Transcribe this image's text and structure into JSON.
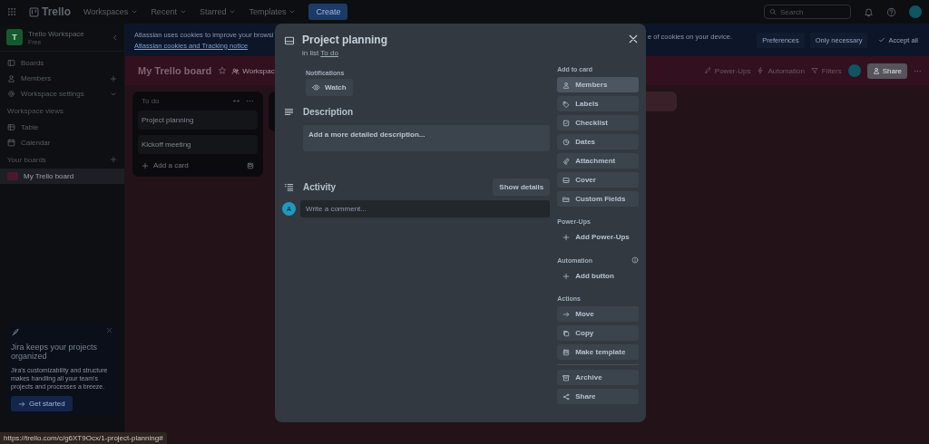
{
  "top_nav": {
    "logo": "Trello",
    "menus": [
      {
        "label": "Workspaces"
      },
      {
        "label": "Recent"
      },
      {
        "label": "Starred"
      },
      {
        "label": "Templates"
      }
    ],
    "create": "Create",
    "search": {
      "placeholder": "Search"
    }
  },
  "sidebar": {
    "workspace": {
      "initial": "T",
      "name": "Trello Workspace",
      "plan": "Free"
    },
    "items": [
      {
        "label": "Boards"
      },
      {
        "label": "Members"
      },
      {
        "label": "Workspace settings"
      }
    ],
    "views_heading": "Workspace views",
    "views": [
      {
        "label": "Table"
      },
      {
        "label": "Calendar"
      }
    ],
    "boards_heading": "Your boards",
    "boards": [
      {
        "label": "My Trello board",
        "selected": true
      }
    ],
    "promo": {
      "title": "Jira keeps your projects organized",
      "body": "Jira's customizability and structure makes handling all your team's projects and processes a breeze.",
      "button": "Get started"
    }
  },
  "cookie_banner": {
    "text_left": "Atlassian uses cookies to improve your browsi",
    "link": "Atlassian cookies and Tracking notice",
    "text_right": "e of cookies on your device.",
    "buttons": [
      {
        "label": "Preferences",
        "kind": "plain"
      },
      {
        "label": "Only necessary",
        "kind": "plain"
      },
      {
        "label": "Accept all",
        "kind": "check"
      }
    ]
  },
  "board": {
    "title": "My Trello board",
    "visibility": "Workspac",
    "actions": [
      {
        "label": "Power-Ups"
      },
      {
        "label": "Automation"
      },
      {
        "label": "Filters"
      }
    ],
    "share": "Share",
    "lists": [
      {
        "title": "To do",
        "cards": [
          "Project planning",
          "Kickoff meeting"
        ],
        "add": "Add a card"
      }
    ]
  },
  "card_modal": {
    "title": "Project planning",
    "list_prefix": "in list",
    "list_name": "To do",
    "notifications_label": "Notifications",
    "watch": "Watch",
    "description_heading": "Description",
    "description_placeholder": "Add a more detailed description...",
    "activity_heading": "Activity",
    "show_details": "Show details",
    "avatar_initial": "A",
    "comment_placeholder": "Write a comment...",
    "sections": [
      {
        "heading": "Add to card",
        "info": false,
        "groups": [
          [
            {
              "label": "Members",
              "kind": "button",
              "highlighted": true
            },
            {
              "label": "Labels",
              "kind": "button",
              "highlighted": false
            },
            {
              "label": "Checklist",
              "kind": "button",
              "highlighted": false
            },
            {
              "label": "Dates",
              "kind": "button",
              "highlighted": false
            },
            {
              "label": "Attachment",
              "kind": "button",
              "highlighted": false
            },
            {
              "label": "Cover",
              "kind": "button",
              "highlighted": false
            },
            {
              "label": "Custom Fields",
              "kind": "button",
              "highlighted": false
            }
          ]
        ]
      },
      {
        "heading": "Power-Ups",
        "info": false,
        "groups": [
          [
            {
              "label": "Add Power-Ups",
              "kind": "link",
              "highlighted": false
            }
          ]
        ]
      },
      {
        "heading": "Automation",
        "info": true,
        "groups": [
          [
            {
              "label": "Add button",
              "kind": "link",
              "highlighted": false
            }
          ]
        ]
      },
      {
        "heading": "Actions",
        "info": false,
        "groups": [
          [
            {
              "label": "Move",
              "kind": "button",
              "highlighted": false
            },
            {
              "label": "Copy",
              "kind": "button",
              "highlighted": false
            },
            {
              "label": "Make template",
              "kind": "button",
              "highlighted": false
            }
          ],
          [
            {
              "label": "Archive",
              "kind": "button",
              "highlighted": false
            },
            {
              "label": "Share",
              "kind": "button",
              "highlighted": false
            }
          ]
        ]
      }
    ]
  },
  "status_url": "https://trello.com/c/g6XT9Ocx/1-project-planning#"
}
